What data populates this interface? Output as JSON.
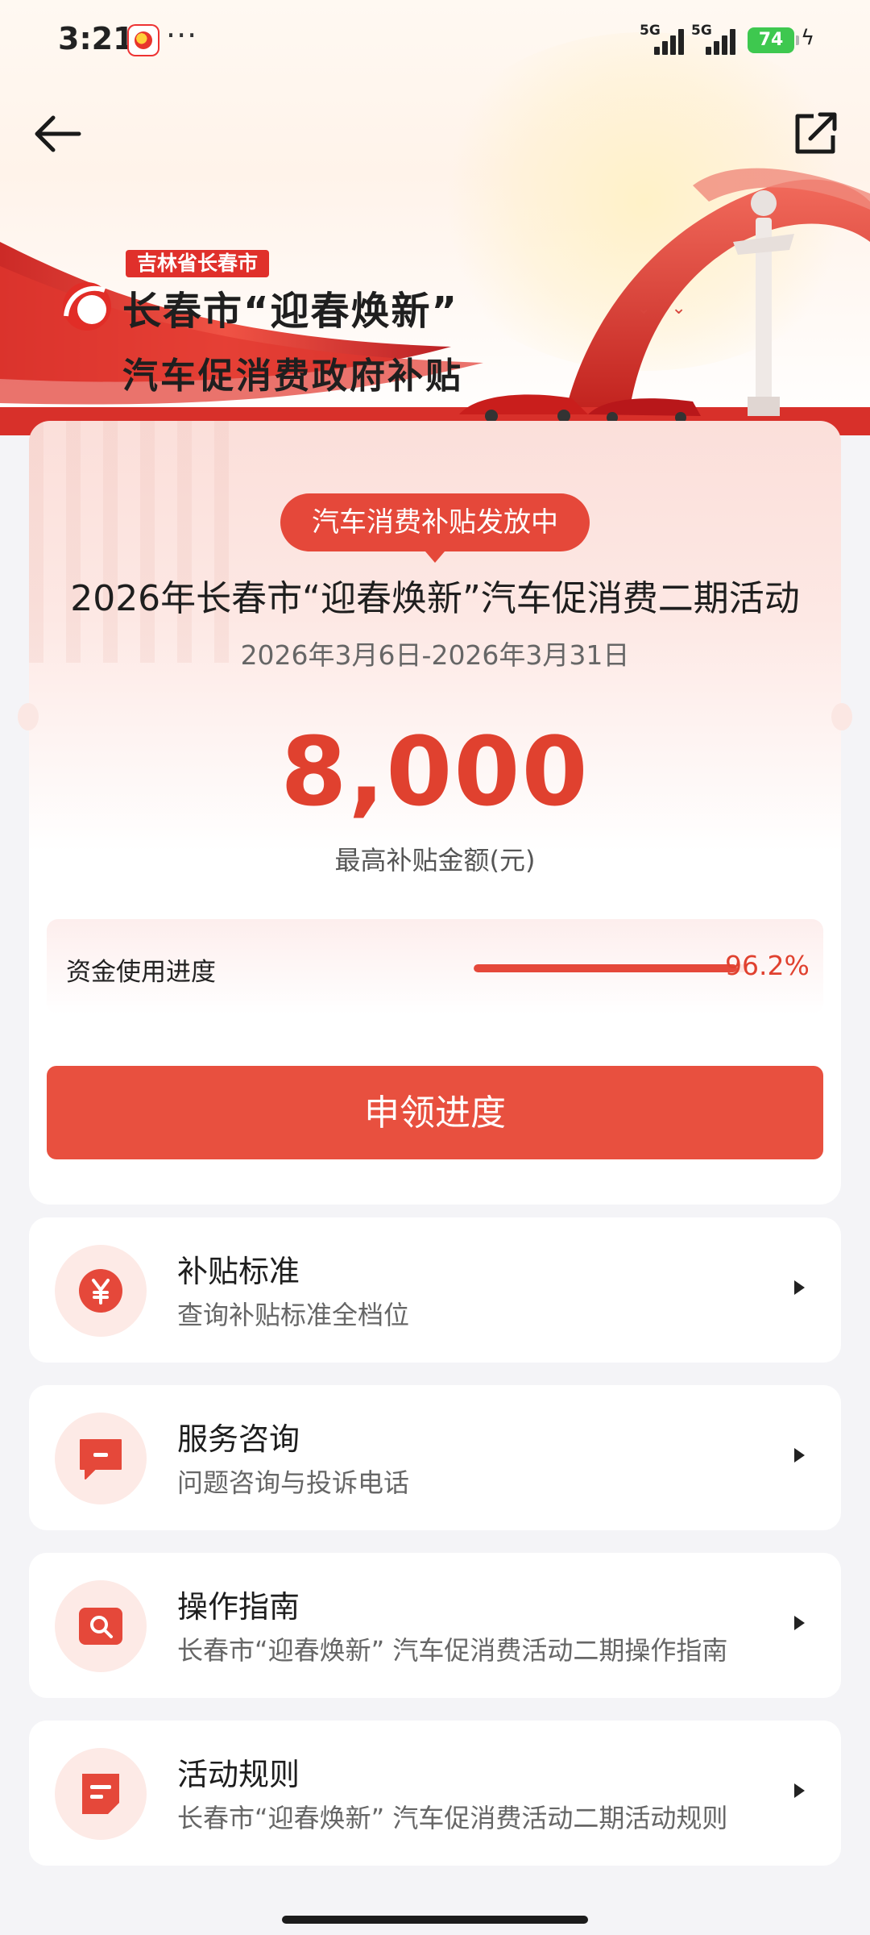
{
  "status_bar": {
    "time": "3:21",
    "more": "···",
    "signal1_label": "5G",
    "signal2_label": "5G",
    "battery_level": "74"
  },
  "banner": {
    "region_tag": "吉林省长春市",
    "title_line1": "长春市“迎春焕新”",
    "title_line2": "汽车促消费政府补贴"
  },
  "main": {
    "status_pill": "汽车消费补贴发放中",
    "activity_title": "2026年长春市“迎春焕新”汽车促消费二期活动",
    "dates": "2026年3月6日-2026年3月31日",
    "amount": "8,000",
    "amount_label": "最高补贴金额(元)",
    "progress_label": "资金使用进度",
    "progress_percent": "96.2%",
    "progress_value": 0.962,
    "apply_button": "申领进度"
  },
  "menu": [
    {
      "title": "补贴标准",
      "subtitle": "查询补贴标准全档位",
      "icon": "yuan-icon"
    },
    {
      "title": "服务咨询",
      "subtitle": "问题咨询与投诉电话",
      "icon": "chat-icon"
    },
    {
      "title": "操作指南",
      "subtitle": "长春市“迎春焕新” 汽车促消费活动二期操作指南",
      "icon": "search-doc-icon"
    },
    {
      "title": "活动规则",
      "subtitle": "长春市“迎春焕新” 汽车促消费活动二期活动规则",
      "icon": "document-icon"
    }
  ],
  "colors": {
    "accent": "#e5483a",
    "amount": "#e0412f",
    "icon_bg": "#fdeae6"
  }
}
